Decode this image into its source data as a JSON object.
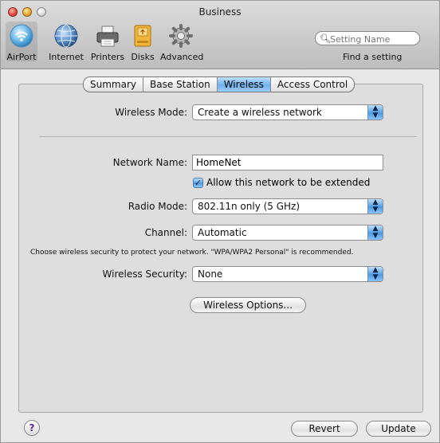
{
  "window": {
    "title": "Business"
  },
  "toolbar": {
    "items": [
      {
        "label": "AirPort",
        "icon": "airport-icon"
      },
      {
        "label": "Internet",
        "icon": "globe-icon"
      },
      {
        "label": "Printers",
        "icon": "printer-icon"
      },
      {
        "label": "Disks",
        "icon": "disk-icon"
      },
      {
        "label": "Advanced",
        "icon": "gear-icon"
      }
    ],
    "search_placeholder": "Setting Name",
    "find_label": "Find a setting"
  },
  "tabs": [
    {
      "label": "Summary"
    },
    {
      "label": "Base Station"
    },
    {
      "label": "Wireless",
      "active": true
    },
    {
      "label": "Access Control"
    }
  ],
  "form": {
    "wireless_mode": {
      "label": "Wireless Mode:",
      "value": "Create a wireless network"
    },
    "network_name": {
      "label": "Network Name:",
      "value": "HomeNet"
    },
    "allow_extend": {
      "label": "Allow this network to be extended",
      "checked": true
    },
    "radio_mode": {
      "label": "Radio Mode:",
      "value": "802.11n only (5 GHz)"
    },
    "channel": {
      "label": "Channel:",
      "value": "Automatic"
    },
    "security_hint": "Choose wireless security to protect your network. \"WPA/WPA2 Personal\" is recommended.",
    "wireless_security": {
      "label": "Wireless Security:",
      "value": "None"
    },
    "wireless_options_label": "Wireless Options..."
  },
  "footer": {
    "help_label": "?",
    "revert_label": "Revert",
    "update_label": "Update"
  },
  "colors": {
    "accent": "#6eb1f0",
    "panel": "#dedede"
  }
}
